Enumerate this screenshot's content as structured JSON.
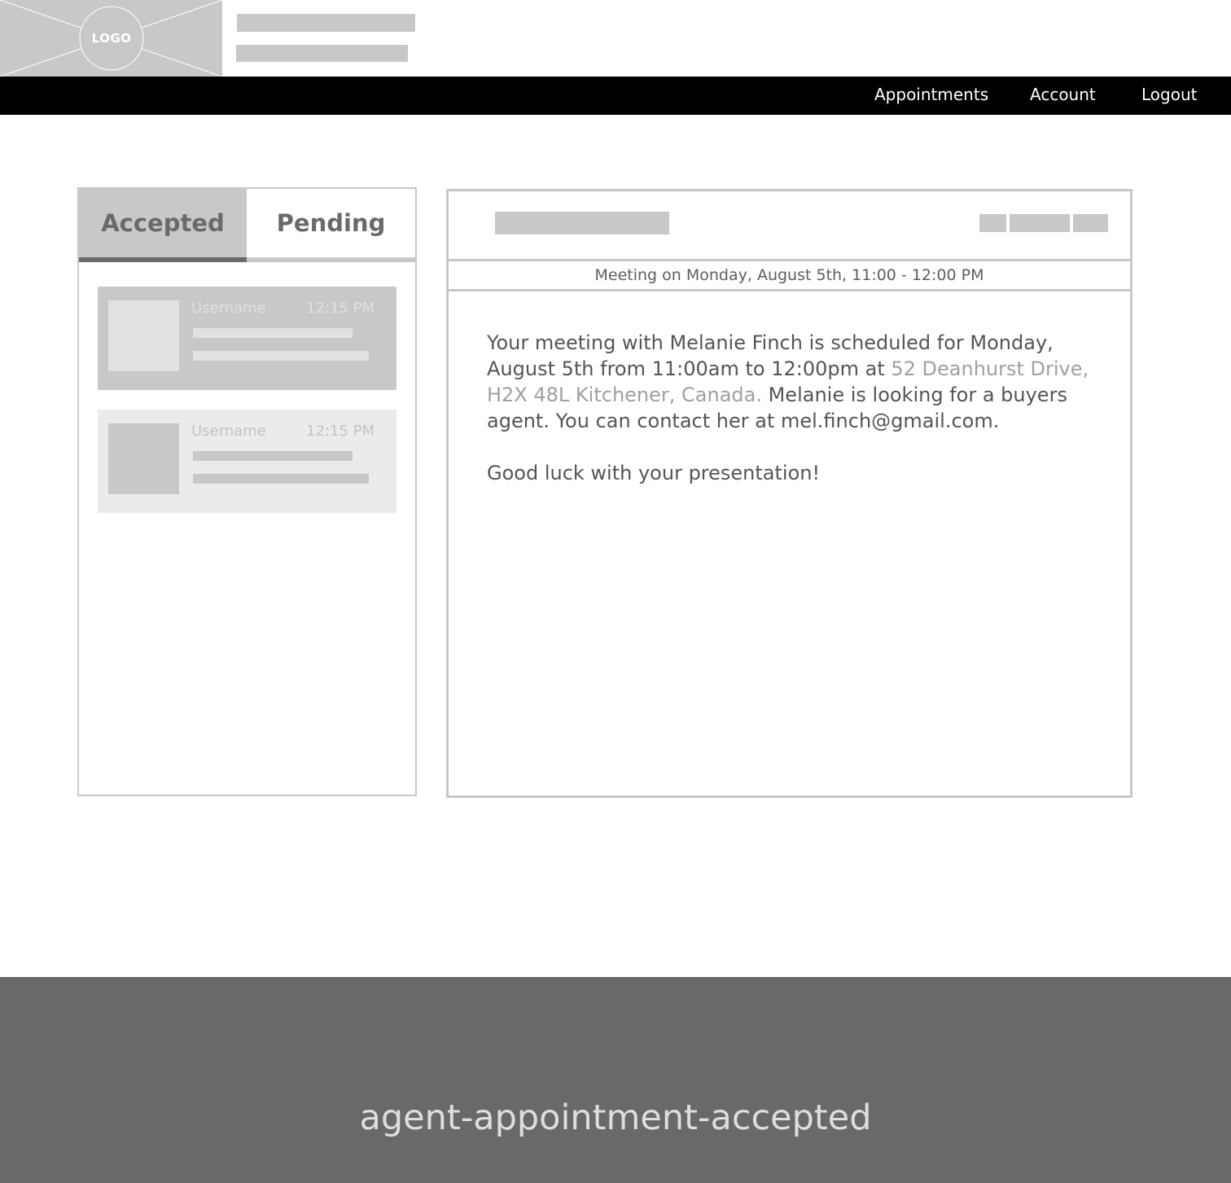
{
  "header": {
    "logo_text": "LOGO"
  },
  "nav": {
    "items": [
      "Appointments",
      "Account",
      "Logout"
    ]
  },
  "tabs": {
    "accepted": "Accepted",
    "pending": "Pending",
    "active": "Accepted"
  },
  "list": {
    "items": [
      {
        "username": "Username",
        "time": "12:15 PM",
        "selected": true
      },
      {
        "username": "Username",
        "time": "12:15 PM",
        "selected": false
      }
    ]
  },
  "detail": {
    "subheader": "Meeting on Monday, August 5th, 11:00 - 12:00 PM",
    "message_part1": "Your meeting with Melanie Finch is scheduled for Monday, August 5th from 11:00am to 12:00pm at ",
    "address": "52 Deanhurst Drive, H2X 48L Kitchener, Canada.",
    "message_part2": " Melanie is looking for a buyers agent. You can contact her at mel.finch@gmail.com.",
    "closing": "Good luck with your presentation!"
  },
  "footer": {
    "label": "agent-appointment-accepted"
  },
  "colors": {
    "placeholder_gray": "#c8c8c6",
    "navbar": "#000000",
    "footer": "#696969",
    "active_tab_underline": "#6a6a6a",
    "address_text": "#a0a0a0"
  }
}
